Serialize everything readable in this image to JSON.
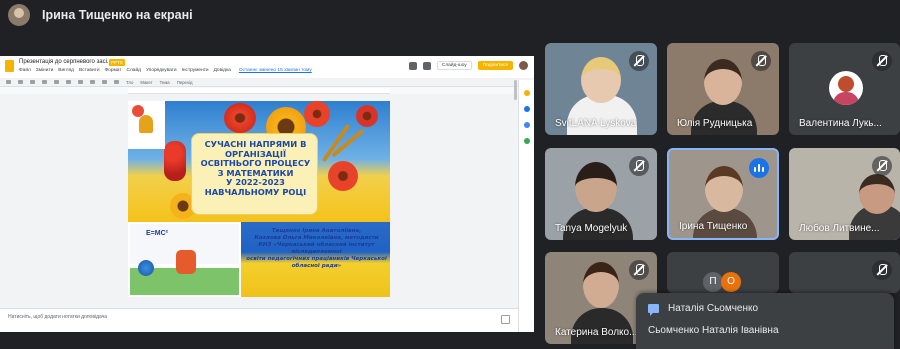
{
  "presenter": {
    "title": "Ірина Тищенко на екрані"
  },
  "slides_app": {
    "doc_name": "Презентація до серпневого засі...",
    "format_tag": "PPTX",
    "menus": [
      "Файл",
      "Змінити",
      "Вигляд",
      "Вставити",
      "Формат",
      "Слайд",
      "Упорядкувати",
      "Інструменти",
      "Довідка"
    ],
    "last_edit": "Останнє змінено 15 хвилин тому",
    "slideshow_button": "Слайд-шоу",
    "share_button": "Поділитися",
    "toolbar_items": [
      "Тло",
      "Макет",
      "Тема",
      "Перехід"
    ],
    "notes_placeholder": "Натисніть, щоб додати нотатки доповідача"
  },
  "slide": {
    "title_lines": [
      "СУЧАСНІ НАПРЯМИ В",
      "ОРГАНІЗАЦІЇ",
      "ОСВІТНЬОГО ПРОЦЕСУ",
      "З МАТЕМАТИКИ",
      "У 2022-2023",
      "НАВЧАЛЬНОМУ РОЦІ"
    ],
    "photo_formula": "E=MC²",
    "authors_lines": [
      "Тищенко Ірина Анатоліївна,",
      "Козлова Ольга Миколаївна, методисти",
      "КНЗ «Черкаський обласний інститут",
      "післядипломної",
      "освіти педагогічних працівників Черкаської",
      "обласної ради»"
    ]
  },
  "participants": [
    {
      "name": "SvitLANA Lyskova",
      "muted": true
    },
    {
      "name": "Юлія Рудницька",
      "muted": true
    },
    {
      "name": "Валентина Лукь...",
      "muted": true
    },
    {
      "name": "Tanya Mogelyuk",
      "muted": true
    },
    {
      "name": "Ірина Тищенко",
      "muted": false
    },
    {
      "name": "Любов Литвине...",
      "muted": true
    },
    {
      "name": "Катерина Волко...",
      "muted": true
    },
    {
      "name": "",
      "muted": false
    },
    {
      "name": "",
      "muted": true
    }
  ],
  "notification": {
    "sender": "Наталія Сьомченко",
    "message": "Сьомченко Наталія Іванівна"
  },
  "colors": {
    "background": "#202124",
    "tile": "#3c4043",
    "speaking": "#1a73e8",
    "slides_accent": "#f4b400"
  }
}
